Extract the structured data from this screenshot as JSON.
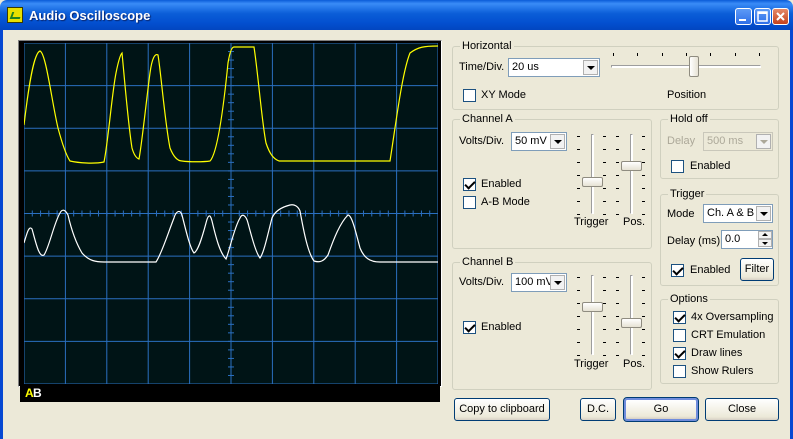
{
  "window": {
    "title": "Audio Oscilloscope",
    "accent": "#0350d0"
  },
  "scope": {
    "background": "#000000",
    "grid_color": "#2a6fc0",
    "trace_a_color": "#ffff00",
    "trace_b_color": "#ffffff",
    "label_a": "A",
    "label_b": "B"
  },
  "horizontal": {
    "title": "Horizontal",
    "time_div_label": "Time/Div.",
    "time_div_value": "20 us",
    "xy_mode_label": "XY Mode",
    "xy_mode_checked": false,
    "position_label": "Position",
    "position_level": 0.55
  },
  "channel_a": {
    "title": "Channel A",
    "volts_div_label": "Volts/Div.",
    "volts_div_value": "50 mV",
    "enabled_label": "Enabled",
    "enabled_checked": true,
    "ab_mode_label": "A-B Mode",
    "ab_mode_checked": false,
    "trigger_label": "Trigger",
    "pos_label": "Pos.",
    "trigger_level": 0.6,
    "pos_level": 0.4
  },
  "channel_b": {
    "title": "Channel B",
    "volts_div_label": "Volts/Div.",
    "volts_div_value": "100 mV",
    "enabled_label": "Enabled",
    "enabled_checked": true,
    "trigger_label": "Trigger",
    "pos_label": "Pos.",
    "trigger_level": 0.4,
    "pos_level": 0.6
  },
  "hold_off": {
    "title": "Hold off",
    "delay_label": "Delay",
    "delay_value": "500 ms",
    "enabled_label": "Enabled",
    "enabled_checked": false
  },
  "trigger": {
    "title": "Trigger",
    "mode_label": "Mode",
    "mode_value": "Ch. A & B",
    "delay_label": "Delay (ms)",
    "delay_value": "0.0",
    "enabled_label": "Enabled",
    "enabled_checked": true,
    "filter_label": "Filter"
  },
  "options": {
    "title": "Options",
    "items": [
      {
        "label": "4x Oversampling",
        "checked": true
      },
      {
        "label": "CRT Emulation",
        "checked": false
      },
      {
        "label": "Draw lines",
        "checked": true
      },
      {
        "label": "Show Rulers",
        "checked": false
      }
    ]
  },
  "buttons": {
    "copy": "Copy to clipboard",
    "dc": "D.C.",
    "go": "Go",
    "close": "Close"
  }
}
